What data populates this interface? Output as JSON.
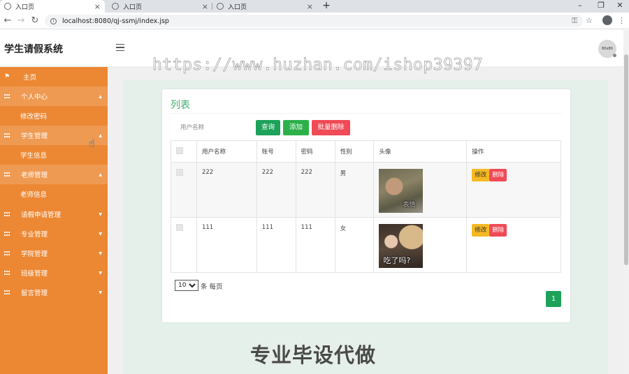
{
  "browser": {
    "tabs": [
      {
        "label": "入口页",
        "active": true
      },
      {
        "label": "入口页",
        "active": false
      },
      {
        "label": "入口页",
        "active": false
      }
    ],
    "new_tab": "+",
    "url": "localhost:8080/qj-ssmj/index.jsp",
    "window_controls": {
      "minimize": "–",
      "restore": "❐",
      "close": "✕"
    }
  },
  "header": {
    "title": "学生请假系统",
    "avatar_text": "80x80",
    "watermark_url": "https://www.huzhan.com/ishop39397"
  },
  "sidebar": {
    "items": [
      {
        "label": "主页",
        "type": "home",
        "icon": "flag-icon"
      },
      {
        "label": "个人中心",
        "type": "parent",
        "icon": "grid-icon",
        "caret": "▲"
      },
      {
        "label": "修改密码",
        "type": "sub"
      },
      {
        "label": "学生管理",
        "type": "parent",
        "icon": "grid-icon",
        "caret": "▲"
      },
      {
        "label": "学生信息",
        "type": "sub"
      },
      {
        "label": "老师管理",
        "type": "parent",
        "icon": "grid-icon",
        "caret": "▲"
      },
      {
        "label": "老师信息",
        "type": "sub"
      },
      {
        "label": "请假申请管理",
        "type": "parent-plain",
        "icon": "grid-icon",
        "caret": "▼"
      },
      {
        "label": "专业管理",
        "type": "parent-plain",
        "icon": "grid-icon",
        "caret": "▼"
      },
      {
        "label": "学院管理",
        "type": "parent-plain",
        "icon": "grid-icon",
        "caret": "▼"
      },
      {
        "label": "班级管理",
        "type": "parent-plain",
        "icon": "grid-icon",
        "caret": "▼"
      },
      {
        "label": "留言管理",
        "type": "parent-plain",
        "icon": "grid-icon",
        "caret": "▼"
      }
    ]
  },
  "main": {
    "card_title": "列表",
    "search": {
      "placeholder": "用户名称",
      "value": ""
    },
    "buttons": {
      "query": "查询",
      "add": "添加",
      "batch_delete": "批量删除"
    },
    "table": {
      "columns": [
        "用户名称",
        "账号",
        "密码",
        "性别",
        "头像",
        "操作"
      ],
      "rows": [
        {
          "username": "222",
          "account": "222",
          "password": "222",
          "gender": "男",
          "avatar_caption": "表情",
          "actions": {
            "edit": "修改",
            "delete": "删除"
          }
        },
        {
          "username": "111",
          "account": "111",
          "password": "111",
          "gender": "女",
          "avatar_caption": "吃了吗?",
          "actions": {
            "edit": "修改",
            "delete": "删除"
          }
        }
      ]
    },
    "pagination": {
      "page_size": "10",
      "page_size_options": [
        "10"
      ],
      "page_size_label": "条 每页",
      "current_page": "1"
    }
  },
  "bottom_watermark": "专业毕设代做",
  "colors": {
    "sidebar": "#ec8834",
    "sidebar_highlight": "#ef9a52",
    "accent_green": "#1ea25a",
    "danger": "#ef4a55",
    "warning": "#f5b922"
  }
}
